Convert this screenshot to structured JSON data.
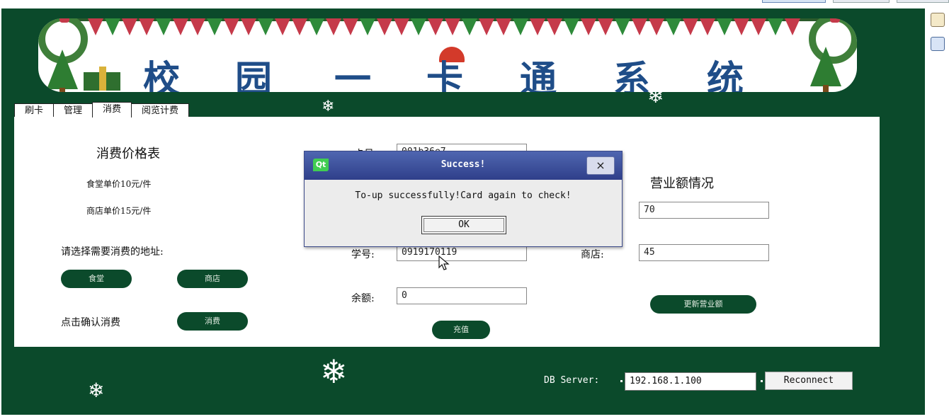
{
  "banner": {
    "title_chars": [
      "校",
      "园",
      "一",
      "卡",
      "通",
      "系",
      "统"
    ]
  },
  "tabs": [
    {
      "label": "刷卡"
    },
    {
      "label": "管理"
    },
    {
      "label": "消费",
      "active": true
    },
    {
      "label": "阅览计费"
    }
  ],
  "consume": {
    "price_title": "消费价格表",
    "canteen_price": "食堂单价10元/件",
    "shop_price": "商店单价15元/件",
    "choose_location_label": "请选择需要消费的地址:",
    "canteen_button": "食堂",
    "shop_button": "商店",
    "confirm_label": "点击确认消费",
    "consume_button": "消费"
  },
  "card": {
    "card_no_label": "卡号",
    "card_no_value": "001b36e7",
    "student_no_label": "学号:",
    "student_no_value": "0919170119",
    "balance_label": "余额:",
    "balance_value": "0",
    "recharge_button": "充值"
  },
  "revenue": {
    "title": "营业额情况",
    "canteen_value": "70",
    "shop_label": "商店:",
    "shop_value": "45",
    "update_button": "更新营业额"
  },
  "db": {
    "label": "DB Server:",
    "server_value": "192.168.1.100",
    "reconnect_button": "Reconnect"
  },
  "dialog": {
    "logo": "Qt",
    "title": "Success!",
    "close_glyph": "×",
    "message": "To-up successfully!Card again to check!",
    "ok_button": "OK"
  },
  "colors": {
    "window_bg": "#0b4a2b",
    "button_bg": "#0b4a2b",
    "banner_text": "#1f4d88",
    "dialog_titlebar": "#3a4c9a"
  },
  "icons": {
    "snowflake": "snowflake-icon",
    "cursor": "mouse-cursor-icon"
  }
}
